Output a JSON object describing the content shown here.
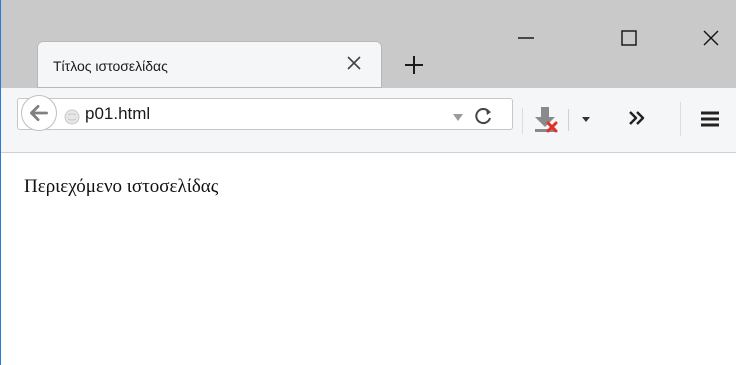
{
  "browser": {
    "tab": {
      "title": "Τίτλος ιστοσελίδας"
    },
    "address_bar": {
      "url": "p01.html"
    }
  },
  "page": {
    "content_text": "Περιεχόμενο ιστοσελίδας"
  },
  "icons": {
    "back": "back-arrow-icon",
    "globe": "globe-icon",
    "dropmarker": "dropdown-triangle-icon",
    "reload": "reload-icon",
    "download": "download-icon",
    "overflow": "chevron-double-right-icon",
    "menu": "hamburger-menu-icon",
    "new_tab": "plus-icon",
    "close_tab": "close-icon",
    "minimize": "minimize-icon",
    "maximize": "maximize-icon",
    "close_window": "close-icon"
  },
  "colors": {
    "titlebar_bg": "#c9c9c9",
    "tab_bg": "#f5f6f7",
    "toolbar_bg": "#f5f6f7",
    "window_border": "#2b7bd6",
    "download_badge": "#e0302a"
  }
}
